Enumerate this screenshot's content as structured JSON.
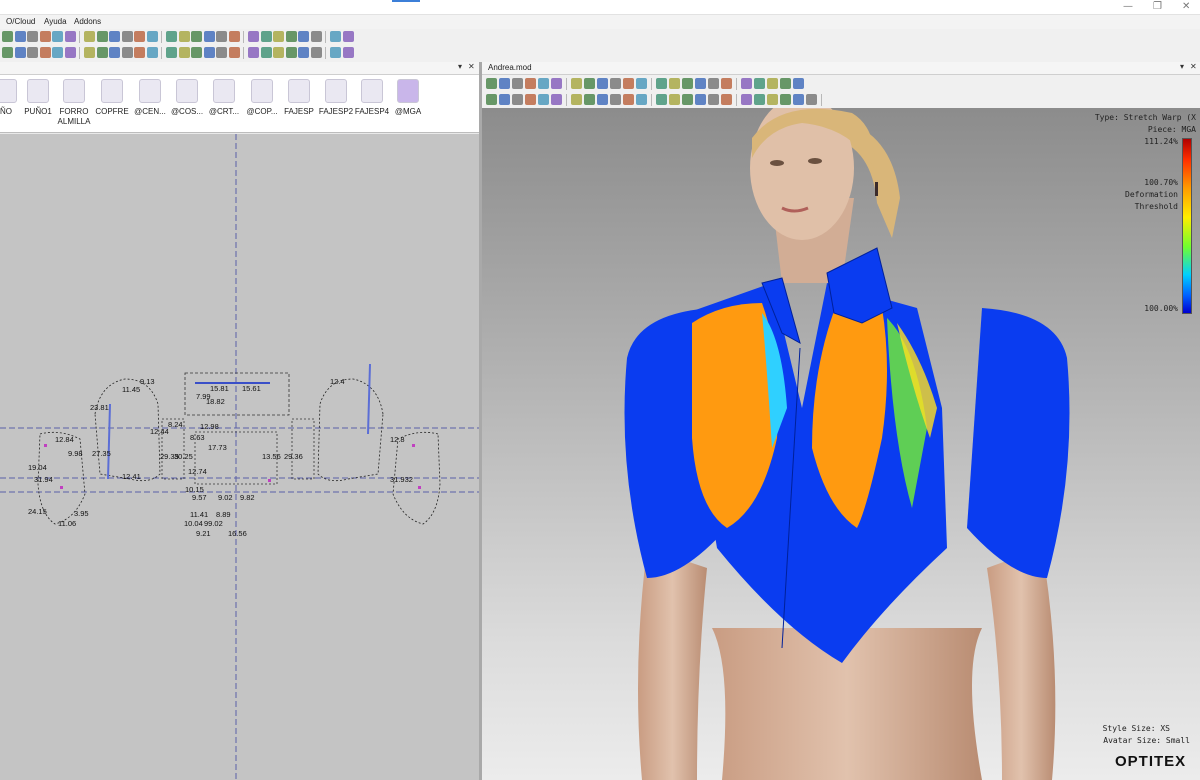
{
  "window": {
    "minimize_glyph": "—",
    "maximize_glyph": "❐",
    "close_glyph": "✕"
  },
  "menu": [
    "O/Cloud",
    "Ayuda",
    "Addons"
  ],
  "left_pane": {
    "close_glyph": "✕",
    "pin_glyph": "▾",
    "pieces": [
      {
        "label": "ÑO"
      },
      {
        "label": "PUÑO1"
      },
      {
        "label": "FORRO ALMILLA"
      },
      {
        "label": "COPFRE"
      },
      {
        "label": "@CEN..."
      },
      {
        "label": "@COS..."
      },
      {
        "label": "@CRT..."
      },
      {
        "label": "@COP..."
      },
      {
        "label": "FAJESP"
      },
      {
        "label": "FAJESP2"
      },
      {
        "label": "FAJESP4"
      },
      {
        "label": "@MGA"
      }
    ],
    "measurements": [
      "9.13",
      "11.45",
      "23.81",
      "12.84",
      "9.98",
      "19.04",
      "31.94",
      "27.35",
      "24.15",
      "11.06",
      "3.95",
      "15.81",
      "15.61",
      "7.99",
      "18.82",
      "12.44",
      "8.24",
      "8.63",
      "17.73",
      "12.98",
      "29.35",
      "30.25",
      "12.74",
      "10.15",
      "9.57",
      "9.02",
      "9.82",
      "11.41",
      "8.89",
      "99.02",
      "10.04",
      "9.21",
      "16.56",
      "13.56",
      "29.36",
      "12.4",
      "12.8",
      "31.932",
      "12.41"
    ]
  },
  "right_pane": {
    "title": "Andrea.mod",
    "close_glyph": "✕",
    "pin_glyph": "▾",
    "info": {
      "type_line": "Type: Stretch Warp (X",
      "piece_line": "Piece: MGA",
      "max_value": "111.24%",
      "threshold_value": "100.70%",
      "threshold_label_1": "Deformation",
      "threshold_label_2": "Threshold",
      "min_value": "100.00%",
      "style_size": "Style Size: XS",
      "avatar_size": "Avatar Size: Small"
    },
    "logo": "OPTITEX"
  },
  "colors": {
    "cool": "#0a3cf0",
    "warm": "#ff9a10",
    "mid": "#2fd0ff",
    "green": "#6fe83a",
    "skin": "#d8b49a",
    "hair": "#d9b679"
  }
}
